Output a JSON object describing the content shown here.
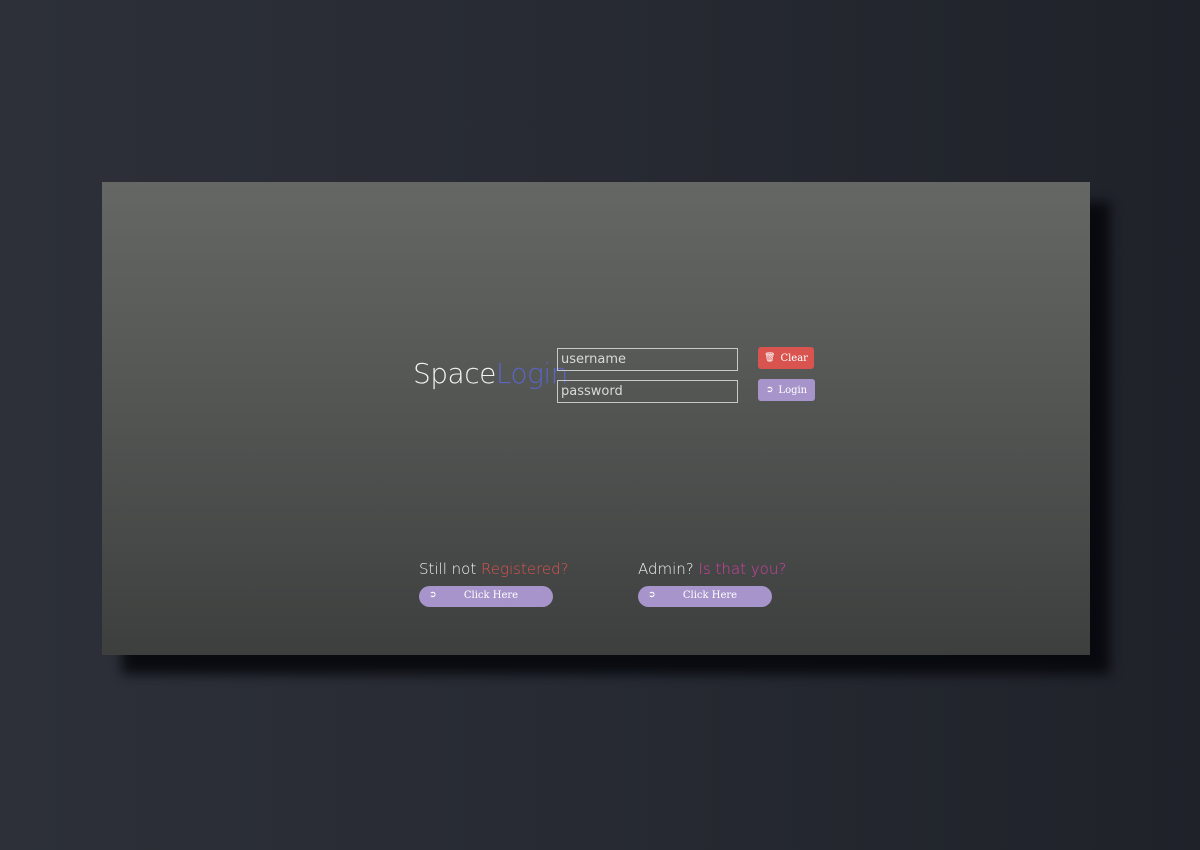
{
  "brand": {
    "part1": "Space",
    "part2": "Login"
  },
  "login_form": {
    "username_placeholder": "username",
    "password_placeholder": "password",
    "username_value": "",
    "password_value": "",
    "clear_label": "Clear",
    "login_label": "Login"
  },
  "register": {
    "prefix": "Still not ",
    "highlight": "Registered?",
    "button_label": "Click Here"
  },
  "admin": {
    "prefix": "Admin? ",
    "highlight": "Is that you?",
    "button_label": "Click Here"
  },
  "icons": {
    "clear": "trash-icon",
    "login": "sign-in-icon",
    "register": "sign-in-icon",
    "admin": "sign-in-icon"
  },
  "colors": {
    "brand_accent": "#5a65c4",
    "clear_button": "#d9534f",
    "primary_button": "#a794cb",
    "register_highlight": "#d9534f",
    "admin_highlight": "#d63fa3"
  }
}
